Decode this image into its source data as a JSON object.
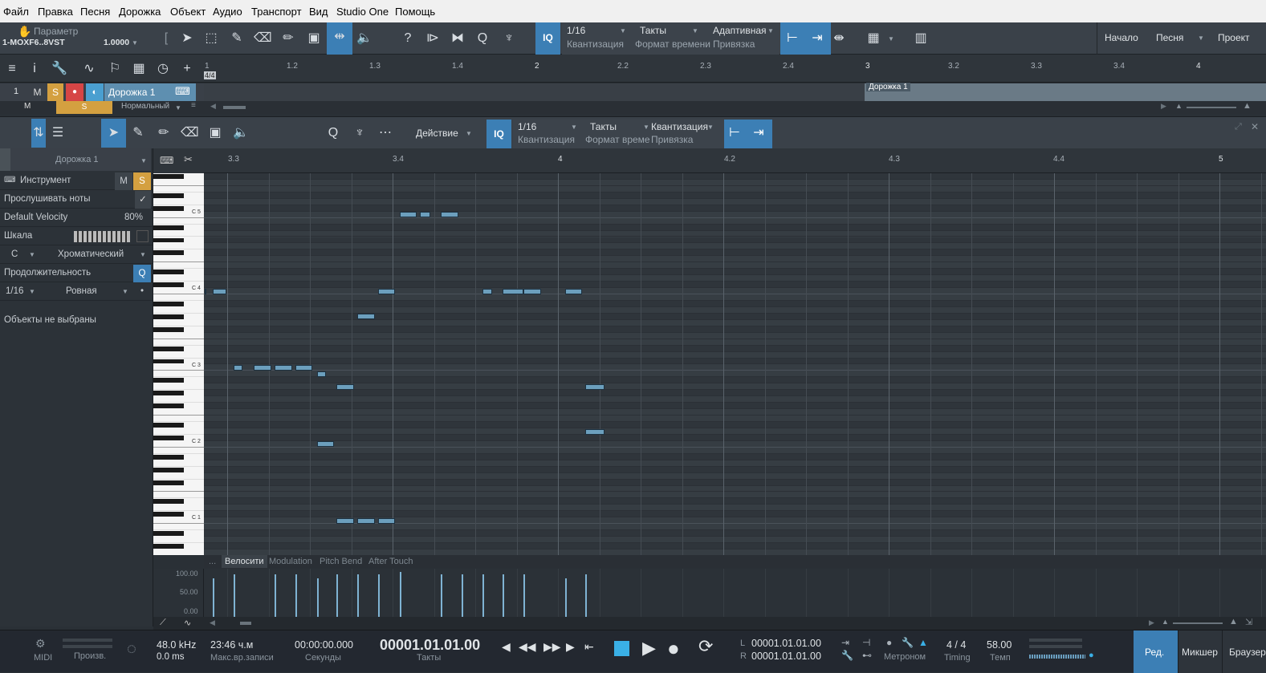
{
  "menu": [
    "Файл",
    "Правка",
    "Песня",
    "Дорожка",
    "Объект",
    "Аудио",
    "Транспорт",
    "Вид",
    "Studio One",
    "Помощь"
  ],
  "toolbar": {
    "param_label": "Параметр",
    "device": "1-MOXF6..8VST",
    "param_value": "1.0000",
    "quant_value": "1/16",
    "quant_label": "Квантизация",
    "time_value": "Такты",
    "time_label": "Формат времени",
    "snap_value": "Адаптивная",
    "snap_label": "Привязка",
    "iq": "IQ",
    "start": "Начало",
    "song": "Песня",
    "project": "Проект"
  },
  "arrange": {
    "ruler": [
      "1",
      "1.2",
      "1.3",
      "1.4",
      "2",
      "2.2",
      "2.3",
      "2.4",
      "3",
      "3.2",
      "3.3",
      "3.4",
      "4"
    ],
    "timesig": "4/4",
    "track_num": "1",
    "track_name": "Дорожка 1",
    "mute": "M",
    "solo": "S",
    "mode": "Нормальный",
    "event_name": "Дорожка 1"
  },
  "editor": {
    "action": "Действие",
    "iq": "IQ",
    "quant_value": "1/16",
    "quant_label": "Квантизация",
    "time_value": "Такты",
    "time_label": "Формат времени",
    "snap_value": "Квантизация",
    "snap_label": "Привязка",
    "ruler": [
      "3.3",
      "3.4",
      "4",
      "4.2",
      "4.3",
      "4.4",
      "5"
    ]
  },
  "panel": {
    "track": "Дорожка 1",
    "instrument": "Инструмент",
    "m": "M",
    "s": "S",
    "listen": "Прослушивать ноты",
    "velocity_label": "Default Velocity",
    "velocity_value": "80%",
    "scale": "Шкала",
    "root": "C",
    "scale_type": "Хроматический",
    "length": "Продолжительность",
    "q": "Q",
    "len_value": "1/16",
    "len_type": "Ровная",
    "no_obj": "Объекты не выбраны"
  },
  "keys": {
    "labels": [
      "C 5",
      "C 4",
      "C 3",
      "C 2",
      "C 1"
    ]
  },
  "lanes": {
    "tabs": [
      "...",
      "Велосити",
      "Modulation",
      "Pitch Bend",
      "After Touch"
    ],
    "axis": [
      "100.00",
      "50.00",
      "0.00"
    ]
  },
  "transport": {
    "midi": "MIDI",
    "perf": "Произв.",
    "rate": "48.0 kHz",
    "latency": "0.0 ms",
    "rec_time": "23:46 ч.м",
    "rec_label": "Макс.вр.записи",
    "seconds": "00:00:00.000",
    "sec_label": "Секунды",
    "bars": "00001.01.01.00",
    "bars_label": "Такты",
    "l_val": "00001.01.01.00",
    "r_val": "00001.01.01.00",
    "l": "L",
    "r": "R",
    "metronome": "Метроном",
    "timing_val": "4 / 4",
    "timing": "Timing",
    "tempo_val": "58.00",
    "tempo": "Темп",
    "edit": "Ред.",
    "mixer": "Микшер",
    "browser": "Браузер"
  },
  "notes": [
    {
      "s": 3.0,
      "l": 0.05,
      "p": 60
    },
    {
      "s": 3.2,
      "l": 0.34,
      "p": 60
    },
    {
      "s": 3.7,
      "l": 0.22,
      "p": 48
    },
    {
      "s": 4.2,
      "l": 0.42,
      "p": 48
    },
    {
      "s": 4.7,
      "l": 0.42,
      "p": 48
    },
    {
      "s": 5.2,
      "l": 0.42,
      "p": 48
    },
    {
      "s": 5.72,
      "l": 0.22,
      "p": 47
    },
    {
      "s": 6.2,
      "l": 0.42,
      "p": 45
    },
    {
      "s": 5.72,
      "l": 0.42,
      "p": 36
    },
    {
      "s": 6.2,
      "l": 0.42,
      "p": 24
    },
    {
      "s": 6.7,
      "l": 0.42,
      "p": 24
    },
    {
      "s": 7.2,
      "l": 0.42,
      "p": 24
    },
    {
      "s": 6.7,
      "l": 0.42,
      "p": 56
    },
    {
      "s": 7.2,
      "l": 0.42,
      "p": 60
    },
    {
      "s": 7.72,
      "l": 0.42,
      "p": 72
    },
    {
      "s": 8.22,
      "l": 0.25,
      "p": 72
    },
    {
      "s": 8.72,
      "l": 0.42,
      "p": 72
    },
    {
      "s": 9.72,
      "l": 0.25,
      "p": 60
    },
    {
      "s": 10.22,
      "l": 0.5,
      "p": 60
    },
    {
      "s": 10.72,
      "l": 0.42,
      "p": 60
    },
    {
      "s": 11.72,
      "l": 0.42,
      "p": 60
    },
    {
      "s": 12.22,
      "l": 0.45,
      "p": 45
    },
    {
      "s": 12.22,
      "l": 0.45,
      "p": 38
    }
  ],
  "velocities": [
    {
      "s": 3.2,
      "v": 0.85
    },
    {
      "s": 3.7,
      "v": 0.95
    },
    {
      "s": 4.7,
      "v": 0.95
    },
    {
      "s": 5.2,
      "v": 0.95
    },
    {
      "s": 5.72,
      "v": 0.85
    },
    {
      "s": 6.2,
      "v": 0.95
    },
    {
      "s": 6.7,
      "v": 0.95
    },
    {
      "s": 7.2,
      "v": 0.95
    },
    {
      "s": 7.72,
      "v": 1.0
    },
    {
      "s": 8.72,
      "v": 0.95
    },
    {
      "s": 9.22,
      "v": 0.95
    },
    {
      "s": 9.72,
      "v": 0.95
    },
    {
      "s": 10.22,
      "v": 0.95
    },
    {
      "s": 10.72,
      "v": 0.95
    },
    {
      "s": 11.72,
      "v": 0.85
    },
    {
      "s": 12.22,
      "v": 0.95
    }
  ]
}
